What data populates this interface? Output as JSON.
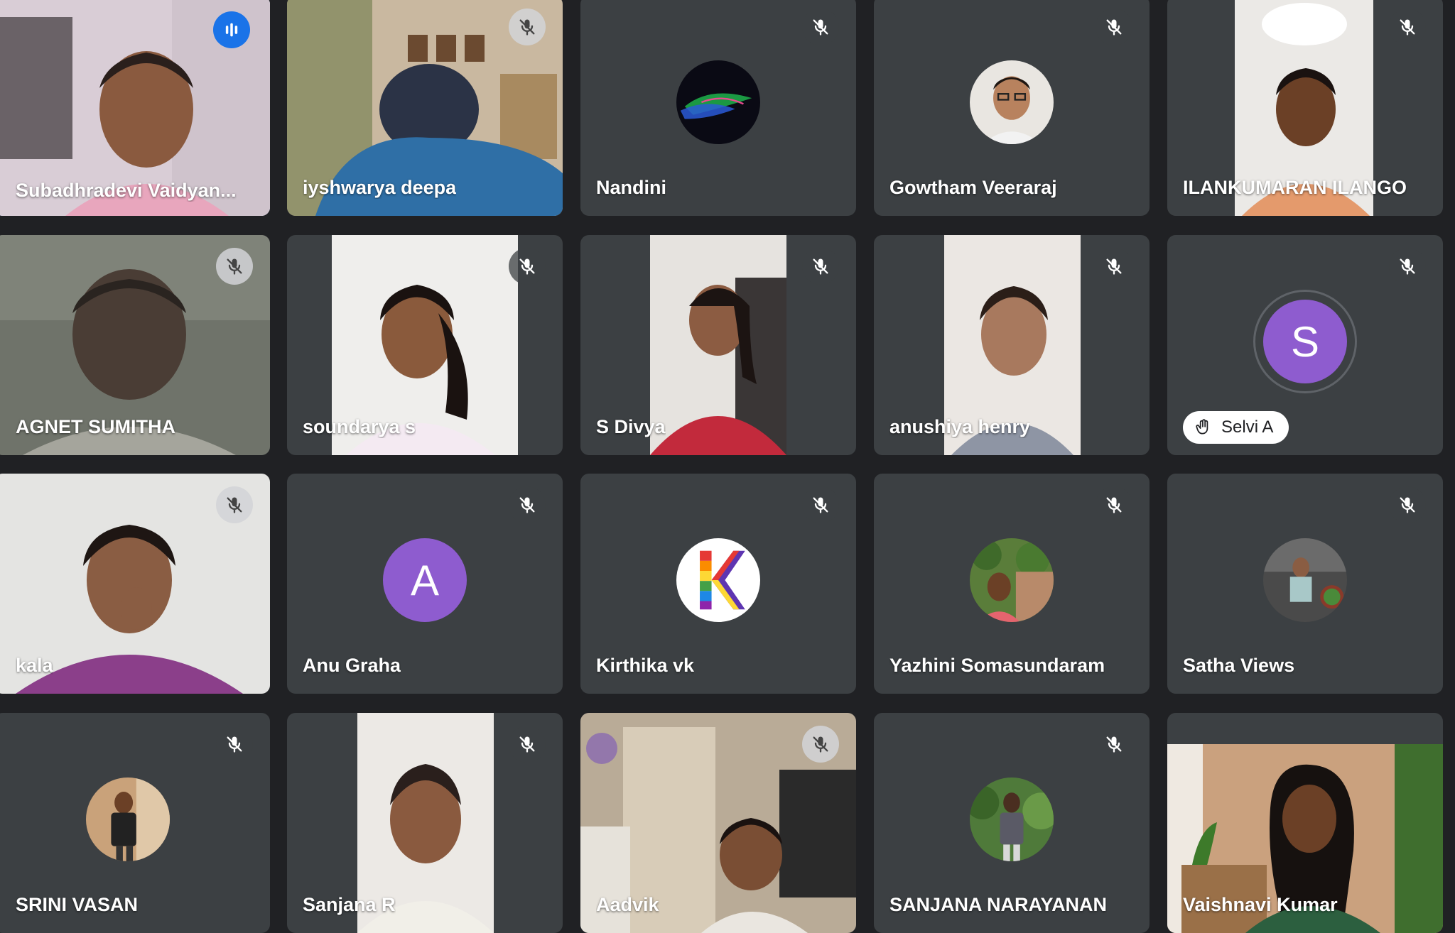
{
  "participants": [
    {
      "name": "Subadhradevi Vaidyan...",
      "status": "speaking",
      "tile_type": "video"
    },
    {
      "name": "iyshwarya deepa",
      "status": "muted",
      "tile_type": "video"
    },
    {
      "name": "Nandini",
      "status": "muted",
      "tile_type": "avatar"
    },
    {
      "name": "Gowtham Veeraraj",
      "status": "muted",
      "tile_type": "avatar"
    },
    {
      "name": "ILANKUMARAN ILANGO",
      "status": "muted",
      "tile_type": "video"
    },
    {
      "name": "AGNET SUMITHA",
      "status": "muted",
      "tile_type": "video"
    },
    {
      "name": "soundarya s",
      "status": "muted",
      "tile_type": "video"
    },
    {
      "name": "S Divya",
      "status": "muted",
      "tile_type": "video"
    },
    {
      "name": "anushiya henry",
      "status": "muted",
      "tile_type": "video"
    },
    {
      "name": "Selvi A",
      "status": "muted",
      "tile_type": "letter",
      "initial": "S",
      "hand_raised": true
    },
    {
      "name": "kala",
      "status": "muted",
      "tile_type": "video"
    },
    {
      "name": "Anu Graha",
      "status": "muted",
      "tile_type": "letter",
      "initial": "A"
    },
    {
      "name": "Kirthika vk",
      "status": "muted",
      "tile_type": "avatar"
    },
    {
      "name": "Yazhini Somasundaram",
      "status": "muted",
      "tile_type": "avatar"
    },
    {
      "name": "Satha Views",
      "status": "muted",
      "tile_type": "avatar"
    },
    {
      "name": "SRINI VASAN",
      "status": "muted",
      "tile_type": "avatar"
    },
    {
      "name": "Sanjana R",
      "status": "muted",
      "tile_type": "video"
    },
    {
      "name": "Aadvik",
      "status": "muted",
      "tile_type": "video"
    },
    {
      "name": "SANJANA NARAYANAN",
      "status": "muted",
      "tile_type": "avatar"
    },
    {
      "name": "Vaishnavi Kumar",
      "status": "unmuted",
      "tile_type": "video"
    }
  ],
  "colors": {
    "background": "#202124",
    "tile": "#3c4043",
    "speaking_border": "#8ab4f8",
    "speaking_indicator": "#1a73e8",
    "letter_avatar": "#8e5ccf"
  },
  "icons": {
    "muted": "mic-off-icon",
    "speaking": "audio-level-icon",
    "hand": "raised-hand-icon"
  }
}
